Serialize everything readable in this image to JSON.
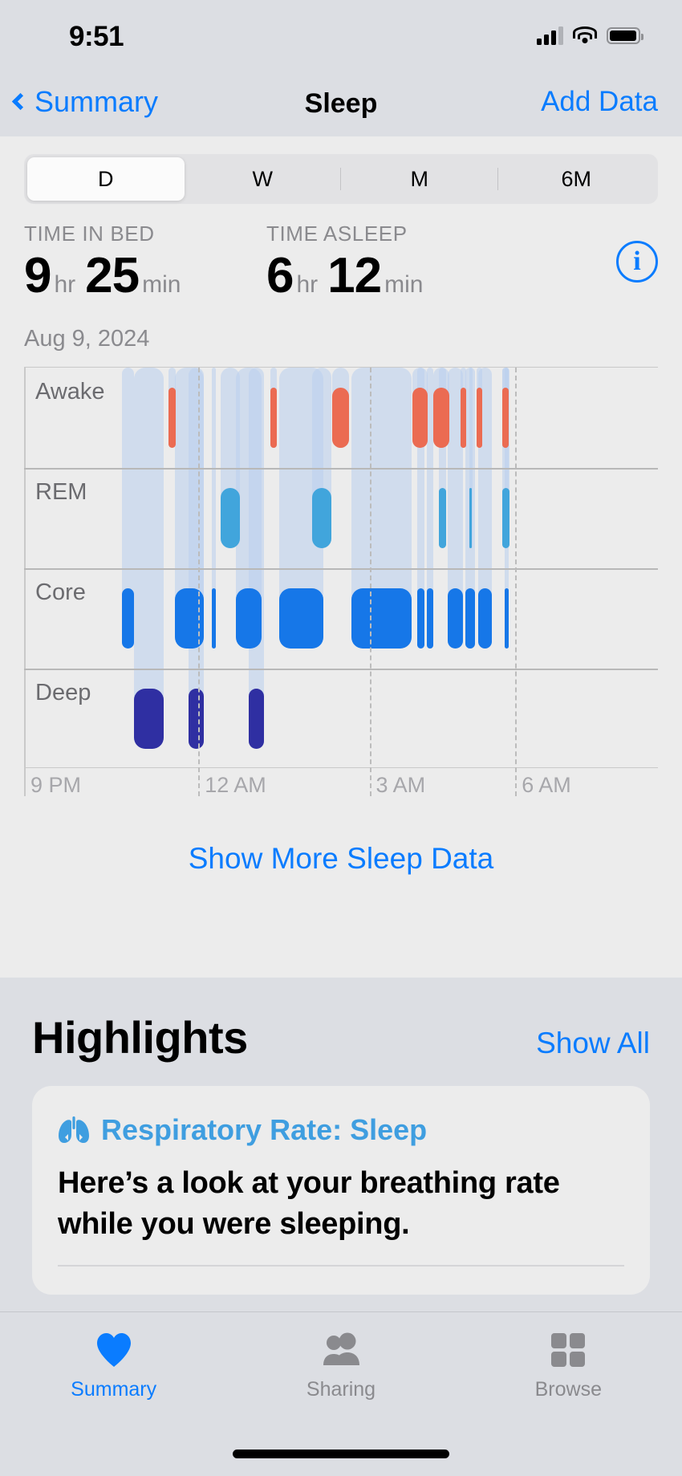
{
  "status_bar": {
    "time": "9:51",
    "cellular_icon": "cellular-signal-icon",
    "wifi_icon": "wifi-icon",
    "battery_icon": "battery-icon"
  },
  "nav": {
    "back_label": "Summary",
    "back_icon": "chevron-left-icon",
    "title": "Sleep",
    "action_label": "Add Data"
  },
  "segmented": {
    "options": [
      "D",
      "W",
      "M",
      "6M"
    ],
    "selected": "D"
  },
  "stats": {
    "time_in_bed": {
      "label": "TIME IN BED",
      "hours": "9",
      "hours_unit": "hr",
      "minutes": "25",
      "minutes_unit": "min"
    },
    "time_asleep": {
      "label": "TIME ASLEEP",
      "hours": "6",
      "hours_unit": "hr",
      "minutes": "12",
      "minutes_unit": "min"
    },
    "info_icon": "info-circle-icon",
    "info_glyph": "i"
  },
  "date_label": "Aug 9, 2024",
  "chart_data": {
    "type": "bar",
    "title": "Sleep Stages",
    "subtitle": "Aug 9, 2024",
    "xlabel": "",
    "ylabel": "",
    "grid": true,
    "legend_position": "none",
    "bands": [
      "Awake",
      "REM",
      "Core",
      "Deep"
    ],
    "band_colors": {
      "Awake": "#eb6b52",
      "REM": "#41a5dc",
      "Core": "#1677e8",
      "Deep": "#2f2fa2"
    },
    "trail_color": "#b9cfee",
    "x_ticks": [
      "9 PM",
      "12 AM",
      "3 AM",
      "6 AM"
    ],
    "x_tick_positions_pct": [
      0,
      27.5,
      54.5,
      77.5
    ],
    "x_range": [
      "9 PM",
      "7:30 AM"
    ],
    "segments": [
      {
        "stage": "Core",
        "start_pct": 15.4,
        "width_pct": 2.0
      },
      {
        "stage": "Awake",
        "start_pct": 22.8,
        "width_pct": 1.1
      },
      {
        "stage": "Deep",
        "start_pct": 17.4,
        "width_pct": 4.6
      },
      {
        "stage": "Core",
        "start_pct": 23.8,
        "width_pct": 4.6
      },
      {
        "stage": "Deep",
        "start_pct": 26.0,
        "width_pct": 2.4
      },
      {
        "stage": "Core",
        "start_pct": 29.6,
        "width_pct": 0.7
      },
      {
        "stage": "REM",
        "start_pct": 31.0,
        "width_pct": 3.0
      },
      {
        "stage": "Core",
        "start_pct": 33.4,
        "width_pct": 4.1
      },
      {
        "stage": "Deep",
        "start_pct": 35.4,
        "width_pct": 2.4
      },
      {
        "stage": "Awake",
        "start_pct": 38.8,
        "width_pct": 1.1
      },
      {
        "stage": "Core",
        "start_pct": 40.2,
        "width_pct": 7.0
      },
      {
        "stage": "REM",
        "start_pct": 45.5,
        "width_pct": 3.0
      },
      {
        "stage": "Awake",
        "start_pct": 48.6,
        "width_pct": 2.7
      },
      {
        "stage": "Core",
        "start_pct": 51.6,
        "width_pct": 9.6
      },
      {
        "stage": "Awake",
        "start_pct": 61.3,
        "width_pct": 2.4
      },
      {
        "stage": "Core",
        "start_pct": 62.0,
        "width_pct": 1.2
      },
      {
        "stage": "Core",
        "start_pct": 63.6,
        "width_pct": 1.0
      },
      {
        "stage": "Awake",
        "start_pct": 64.5,
        "width_pct": 2.6
      },
      {
        "stage": "REM",
        "start_pct": 65.4,
        "width_pct": 1.2
      },
      {
        "stage": "Core",
        "start_pct": 66.8,
        "width_pct": 2.4
      },
      {
        "stage": "Awake",
        "start_pct": 68.9,
        "width_pct": 0.8
      },
      {
        "stage": "REM",
        "start_pct": 70.2,
        "width_pct": 0.4
      },
      {
        "stage": "Core",
        "start_pct": 69.6,
        "width_pct": 1.6
      },
      {
        "stage": "Awake",
        "start_pct": 71.4,
        "width_pct": 0.9
      },
      {
        "stage": "Core",
        "start_pct": 71.6,
        "width_pct": 2.2
      },
      {
        "stage": "Awake",
        "start_pct": 75.4,
        "width_pct": 1.0
      },
      {
        "stage": "REM",
        "start_pct": 75.4,
        "width_pct": 1.2
      },
      {
        "stage": "Core",
        "start_pct": 75.8,
        "width_pct": 0.6
      }
    ]
  },
  "show_more_label": "Show More Sleep Data",
  "highlights": {
    "title": "Highlights",
    "show_all_label": "Show All",
    "card": {
      "icon": "lungs-icon",
      "category": "Respiratory Rate: Sleep",
      "body": "Here’s a look at your breathing rate while you were sleeping."
    }
  },
  "tab_bar": {
    "tabs": [
      {
        "label": "Summary",
        "icon": "heart-icon",
        "active": true
      },
      {
        "label": "Sharing",
        "icon": "people-icon",
        "active": false
      },
      {
        "label": "Browse",
        "icon": "grid-icon",
        "active": false
      }
    ]
  },
  "colors": {
    "accent": "#0a7cff",
    "awake": "#eb6b52",
    "rem": "#41a5dc",
    "core": "#1677e8",
    "deep": "#2f2fa2"
  }
}
